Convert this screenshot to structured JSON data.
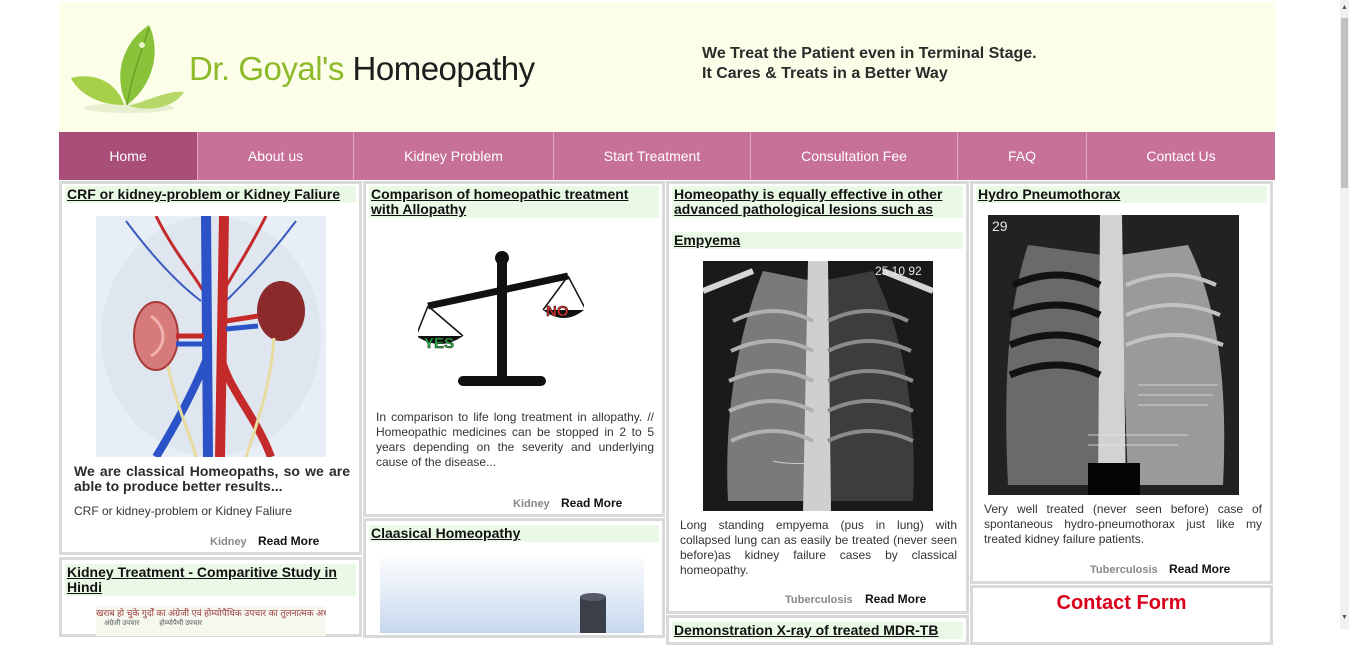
{
  "header": {
    "logo_part1": "Dr. Goyal's",
    "logo_part2": "Homeopathy",
    "tagline_line1": "We Treat the Patient even in Terminal Stage.",
    "tagline_line2": "It Cares & Treats in a Better Way"
  },
  "nav": {
    "items": [
      {
        "label": "Home"
      },
      {
        "label": "About us"
      },
      {
        "label": "Kidney Problem"
      },
      {
        "label": "Start Treatment"
      },
      {
        "label": "Consultation Fee"
      },
      {
        "label": "FAQ"
      },
      {
        "label": "Contact Us"
      }
    ]
  },
  "cards": {
    "crf": {
      "title": "CRF or kidney-problem or Kidney Faliure",
      "headline": "We are classical Homeopaths, so we are able to produce better results...",
      "text": "CRF or kidney-problem or Kidney Faliure",
      "tag": "Kidney",
      "more": "Read More"
    },
    "kidney_treatment": {
      "title": "Kidney Treatment - Comparitive Study in Hindi",
      "image_caption_line1": "खराब हो चुके गुर्दों का अंग्रेजी एवं होम्योपैथिक उपचार का तुलनात्मक अध्ययन",
      "image_caption_line2a": "अंग्रेजी उपचार",
      "image_caption_line2b": "होम्योपैथी उपचार"
    },
    "comparison": {
      "title": "Comparison of homeopathic treatment with Allopathy",
      "scale_yes": "YES",
      "scale_no": "NO",
      "text": "In comparison to life long treatment in allopathy. // Homeopathic medicines can be stopped in 2 to 5 years depending on the severity and underlying cause of the disease...",
      "tag": "Kidney",
      "more": "Read More"
    },
    "classical": {
      "title": "Claasical Homeopathy"
    },
    "empyema": {
      "title": "Homeopathy is equally effective in other advanced pathological lesions such as",
      "subtitle": "Empyema",
      "xray_label": "25 10 92",
      "text": "Long standing empyema (pus in lung) with collapsed lung can as easily be treated (never seen before)as kidney failure cases by classical homeopathy.",
      "tag": "Tuberculosis",
      "more": "Read More"
    },
    "demonstration": {
      "title_partial": "Demonstration X-ray of treated MDR-TB"
    },
    "hydro": {
      "title": "Hydro Pneumothorax",
      "xray_label": "29",
      "text": "Very well treated (never seen before) case of spontaneous hydro-pneumothorax just like my treated kidney failure patients.",
      "tag": "Tuberculosis",
      "more": "Read More"
    },
    "contact": {
      "title": "Contact Form"
    }
  },
  "colors": {
    "nav_bg": "#c77098",
    "nav_active": "#a94e78",
    "header_bg": "#fdfee9",
    "title_bg": "#e9f9e6",
    "logo_green": "#8dba2a",
    "contact_red": "#d9001b"
  }
}
